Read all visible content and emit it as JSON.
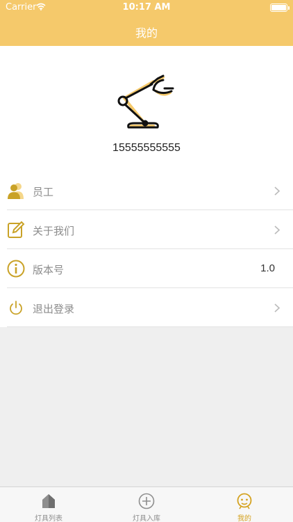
{
  "status_bar": {
    "carrier": "Carrier",
    "time": "10:17 AM"
  },
  "nav": {
    "title": "我的"
  },
  "profile": {
    "phone": "15555555555"
  },
  "menu": [
    {
      "label": "员工",
      "icon": "users-icon"
    },
    {
      "label": "关于我们",
      "icon": "edit-icon"
    },
    {
      "label": "版本号",
      "icon": "info-icon",
      "value": "1.0"
    },
    {
      "label": "退出登录",
      "icon": "power-icon"
    }
  ],
  "tabs": [
    {
      "label": "灯具列表",
      "icon": "house-icon",
      "active": false
    },
    {
      "label": "灯具入库",
      "icon": "add-circle-icon",
      "active": false
    },
    {
      "label": "我的",
      "icon": "smiley-icon",
      "active": true
    }
  ],
  "colors": {
    "accent": "#f5c96b",
    "active_tab": "#d4a21f",
    "icon_gold": "#c9a227"
  }
}
